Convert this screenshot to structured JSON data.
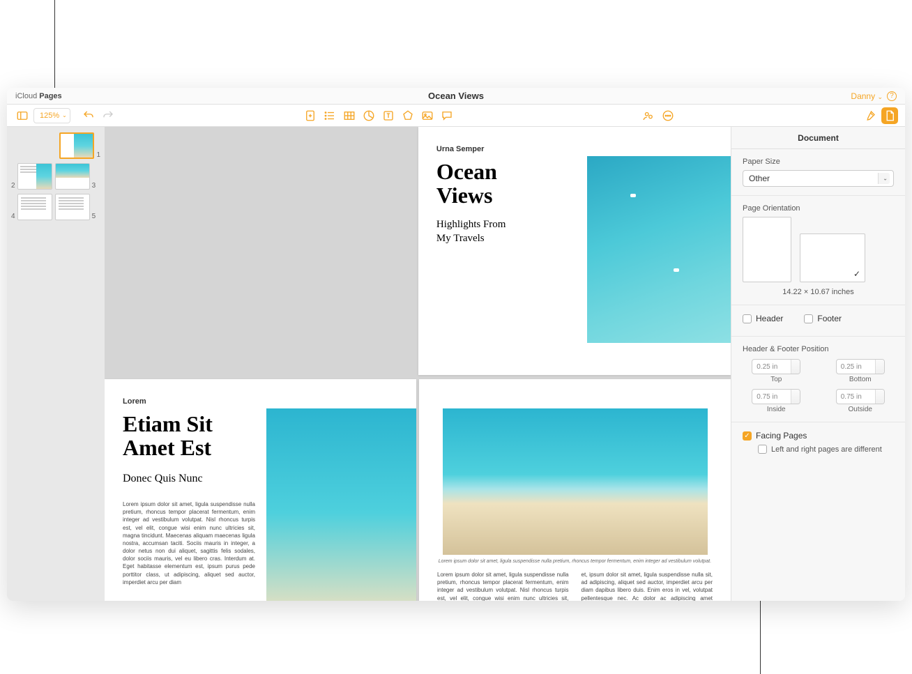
{
  "titlebar": {
    "app_prefix": "iCloud ",
    "app_name": "Pages",
    "doc_title": "Ocean Views",
    "user": "Danny"
  },
  "toolbar": {
    "zoom": "125%"
  },
  "thumbnails": [
    1,
    2,
    3,
    4,
    5
  ],
  "pages": {
    "p1": {
      "header": "Urna Semper",
      "title1": "Ocean",
      "title2": "Views",
      "sub1": "Highlights From",
      "sub2": "My Travels"
    },
    "p2": {
      "header": "Lorem",
      "title1": "Etiam Sit",
      "title2": "Amet Est",
      "subtitle": "Donec Quis Nunc",
      "body": "Lorem ipsum dolor sit amet, ligula suspendisse nulla pretium, rhoncus tempor placerat fermentum, enim integer ad vestibulum volutpat. Nisl rhoncus turpis est, vel elit, congue wisi enim nunc ultricies sit, magna tincidunt. Maecenas aliquam maecenas ligula nostra, accumsan taciti. Sociis mauris in integer, a dolor netus non dui aliquet, sagittis felis sodales, dolor sociis mauris, vel eu libero cras. Interdum at. Eget habitasse elementum est, ipsum purus pede porttitor class, ut adipiscing, aliquet sed auctor, imperdiet arcu per diam"
    },
    "p3": {
      "caption": "Lorem ipsum dolor sit amet, ligula suspendisse nulla pretium, rhoncus tempor fermentum, enim integer ad vestibulum volutpat.",
      "col1": "Lorem ipsum dolor sit amet, ligula suspendisse nulla pretium, rhoncus tempor placerat fermentum, enim integer ad vestibulum volutpat. Nisl rhoncus turpis est, vel elit, congue wisi enim nunc ultricies sit, magna tincidunt. Maecenas aliquam maecenas ligula nostra, accumsan taciti. Sociis",
      "col2": "et, ipsum dolor sit amet, ligula suspendisse nulla sit, ad adipiscing, aliquet sed auctor, imperdiet arcu per diam dapibus libero duis. Enim eros in vel, volutpat pellentesque nec. Ac dolor ac adipiscing amet bibendum nullam, massa lacus molestie ut libero nec, diam et, pharetra sodales eget, feugiat ullamcorper id maecenas justo. Diam non"
    }
  },
  "inspector": {
    "tab": "Document",
    "paper_size_label": "Paper Size",
    "paper_size_value": "Other",
    "orientation_label": "Page Orientation",
    "dimensions": "14.22 × 10.67 inches",
    "header_label": "Header",
    "footer_label": "Footer",
    "hf_position_label": "Header & Footer Position",
    "top_val": "0.25 in",
    "top_label": "Top",
    "bottom_val": "0.25 in",
    "bottom_label": "Bottom",
    "inside_val": "0.75 in",
    "inside_label": "Inside",
    "outside_val": "0.75 in",
    "outside_label": "Outside",
    "facing_pages": "Facing Pages",
    "lr_different": "Left and right pages are different"
  }
}
